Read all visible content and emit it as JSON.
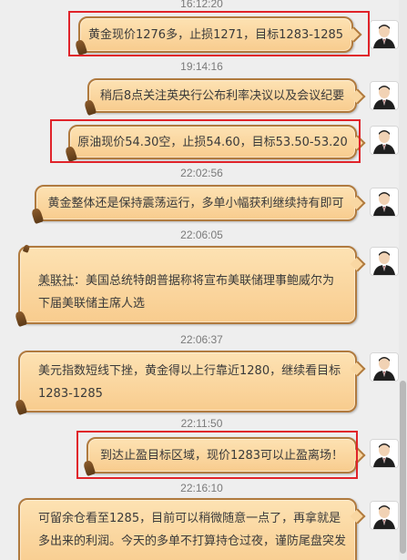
{
  "messages": [
    {
      "time": "16:12:20",
      "text": "黄金现价1276多，止损1271，目标1283-1285"
    },
    {
      "time": "19:14:16",
      "text": "稍后8点关注英央行公布利率决议以及会议纪要"
    },
    {
      "time": "",
      "text": "原油现价54.30空，止损54.60，目标53.50-53.20"
    },
    {
      "time": "22:02:56",
      "text": "黄金整体还是保持震荡运行，多单小幅获利继续持有即可"
    },
    {
      "time": "22:06:05",
      "text_prefix": "美联社",
      "text": "：美国总统特朗普据称将宣布美联储理事鲍威尔为下届美联储主席人选"
    },
    {
      "time": "22:06:37",
      "text": "美元指数短线下挫，黄金得以上行靠近1280，继续看目标1283-1285"
    },
    {
      "time": "22:11:50",
      "text": "到达止盈目标区域，现价1283可以止盈离场！"
    },
    {
      "time": "22:16:10",
      "text_line1": "可留余仓看至1285，目前可以稍微随意一点了，再拿就是",
      "text_line2": "多出来的利润。今天的多单不打算持仓过夜，谨防尾盘突发"
    }
  ],
  "icons": {
    "avatar": "user-avatar-icon"
  },
  "colors": {
    "bubble": "#f8cc8e",
    "bubble_border": "#b07a3e",
    "highlight": "#e0232a",
    "timestamp": "#7a7a7a"
  }
}
